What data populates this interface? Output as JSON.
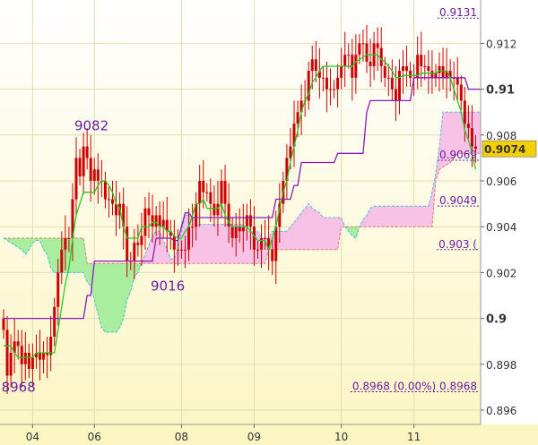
{
  "chart_data": {
    "type": "candlestick",
    "title": "",
    "xlabel": "",
    "ylabel": "",
    "y_range": [
      0.8955,
      0.9135
    ],
    "y_ticks": [
      0.896,
      0.898,
      0.9,
      0.902,
      0.904,
      0.906,
      0.908,
      0.91,
      0.912
    ],
    "y_tick_labels": [
      "0.896",
      "0.898",
      "0.9",
      "0.902",
      "0.904",
      "0.906",
      "0.908",
      "0.91",
      "0.912"
    ],
    "y_major_ticks": [
      0.9,
      0.91
    ],
    "x_tick_labels": [
      "04",
      "06",
      "08",
      "09",
      "10",
      "11"
    ],
    "x_tick_index": [
      8,
      25,
      49,
      69,
      93,
      113
    ],
    "current_price": 0.9074,
    "current_price_label": "0.9074",
    "colors": {
      "background_top": "#ffffff",
      "background_bottom": "#fbf5c2",
      "candle": "#cc0000",
      "tenkan": "#22cc22",
      "kijun": "#8a1ab8",
      "cloud_bull": "#a8ee9e",
      "cloud_bear": "#f8c2e6",
      "annotation": "#6a1fa2",
      "price_badge": "#f5d000"
    },
    "annotations": {
      "swing_high": {
        "label": "9082",
        "value": 0.9082
      },
      "swing_mid": {
        "label": "9016",
        "value": 0.9016
      },
      "swing_low": {
        "label": "8968",
        "value": 0.8968
      }
    },
    "levels": [
      {
        "label": "0.9131",
        "value": 0.9131
      },
      {
        "label": "0.9069",
        "value": 0.9069
      },
      {
        "label": "0.9049",
        "value": 0.9049
      },
      {
        "label": "0.903 (",
        "value": 0.903
      },
      {
        "label": "0.8968 (0.00%) 0.8968",
        "value": 0.8968
      }
    ],
    "closes": [
      0.8995,
      0.8975,
      0.8985,
      0.899,
      0.8988,
      0.898,
      0.8985,
      0.8978,
      0.8983,
      0.8985,
      0.8982,
      0.8985,
      0.8984,
      0.8992,
      0.9005,
      0.902,
      0.903,
      0.9035,
      0.9035,
      0.9052,
      0.907,
      0.9062,
      0.9075,
      0.907,
      0.906,
      0.9065,
      0.906,
      0.906,
      0.9052,
      0.9052,
      0.905,
      0.9045,
      0.905,
      0.904,
      0.9025,
      0.9025,
      0.9033,
      0.9032,
      0.9036,
      0.9048,
      0.9045,
      0.904,
      0.9045,
      0.904,
      0.9043,
      0.9038,
      0.9036,
      0.903,
      0.903,
      0.903,
      0.903,
      0.904,
      0.904,
      0.905,
      0.906,
      0.9055,
      0.9055,
      0.905,
      0.9045,
      0.905,
      0.906,
      0.905,
      0.904,
      0.9035,
      0.904,
      0.9038,
      0.904,
      0.9045,
      0.904,
      0.903,
      0.903,
      0.9035,
      0.9035,
      0.903,
      0.9025,
      0.904,
      0.905,
      0.906,
      0.907,
      0.9075,
      0.9085,
      0.909,
      0.9095,
      0.9095,
      0.9108,
      0.9113,
      0.9108,
      0.9105,
      0.9105,
      0.91,
      0.91,
      0.91,
      0.9105,
      0.911,
      0.9115,
      0.9115,
      0.9105,
      0.9115,
      0.912,
      0.912,
      0.9112,
      0.911,
      0.912,
      0.9118,
      0.911,
      0.9105,
      0.9105,
      0.91,
      0.9095,
      0.9108,
      0.911,
      0.9108,
      0.9105,
      0.9105,
      0.9115,
      0.911,
      0.911,
      0.9108,
      0.9105,
      0.9107,
      0.911,
      0.9105,
      0.9108,
      0.9105,
      0.9105,
      0.9102,
      0.9095,
      0.9085,
      0.9083,
      0.9075,
      0.9074
    ],
    "tenkan": [
      0.8988,
      0.8988,
      0.8988,
      0.8985,
      0.8983,
      0.8983,
      0.8983,
      0.8983,
      0.8983,
      0.8985,
      0.8985,
      0.8985,
      0.8985,
      0.8985,
      0.8985,
      0.8995,
      0.9005,
      0.9015,
      0.9022,
      0.9035,
      0.9045,
      0.905,
      0.9055,
      0.9055,
      0.9055,
      0.9055,
      0.9058,
      0.906,
      0.906,
      0.9058,
      0.9055,
      0.905,
      0.9048,
      0.904,
      0.9035,
      0.9035,
      0.9035,
      0.9035,
      0.904,
      0.904,
      0.904,
      0.9042,
      0.9042,
      0.904,
      0.904,
      0.9038,
      0.9038,
      0.9036,
      0.9035,
      0.9035,
      0.9038,
      0.904,
      0.9045,
      0.905,
      0.905,
      0.9052,
      0.9048,
      0.9048,
      0.9048,
      0.9048,
      0.905,
      0.9045,
      0.9042,
      0.904,
      0.904,
      0.904,
      0.904,
      0.904,
      0.9038,
      0.9036,
      0.9034,
      0.9034,
      0.9034,
      0.903,
      0.9035,
      0.904,
      0.9048,
      0.9055,
      0.906,
      0.9068,
      0.9075,
      0.9082,
      0.909,
      0.9095,
      0.9098,
      0.9103,
      0.9105,
      0.9108,
      0.911,
      0.911,
      0.911,
      0.911,
      0.911,
      0.911,
      0.911,
      0.911,
      0.911,
      0.9112,
      0.9113,
      0.9114,
      0.9115,
      0.9115,
      0.9115,
      0.9115,
      0.9113,
      0.9112,
      0.911,
      0.9108,
      0.9105,
      0.9105,
      0.9106,
      0.9106,
      0.9106,
      0.9106,
      0.9106,
      0.9107,
      0.9107,
      0.9107,
      0.9107,
      0.9107,
      0.9108,
      0.9108,
      0.9108,
      0.9105,
      0.91,
      0.9095,
      0.909,
      0.9082,
      0.9078,
      0.9072,
      0.9065
    ],
    "kijun": [
      0.9,
      0.9,
      0.9,
      0.9,
      0.9,
      0.9,
      0.9,
      0.9,
      0.9,
      0.9,
      0.9,
      0.9,
      0.9,
      0.9,
      0.9,
      0.9,
      0.9,
      0.9,
      0.9,
      0.9,
      0.9,
      0.9,
      0.9,
      0.901,
      0.901,
      0.9025,
      0.9025,
      0.9025,
      0.9025,
      0.9025,
      0.9025,
      0.9025,
      0.9025,
      0.9025,
      0.9025,
      0.9025,
      0.9025,
      0.9025,
      0.9025,
      0.9025,
      0.9025,
      0.9025,
      0.9035,
      0.9035,
      0.9035,
      0.9035,
      0.9035,
      0.9034,
      0.9034,
      0.904,
      0.9046,
      0.9046,
      0.9044,
      0.9044,
      0.9044,
      0.9044,
      0.9044,
      0.9044,
      0.9044,
      0.9044,
      0.9044,
      0.9044,
      0.9044,
      0.9044,
      0.9044,
      0.9044,
      0.9044,
      0.9044,
      0.9044,
      0.9044,
      0.9044,
      0.9044,
      0.9044,
      0.9044,
      0.9044,
      0.9052,
      0.9052,
      0.9052,
      0.9052,
      0.9052,
      0.9058,
      0.9058,
      0.9068,
      0.9068,
      0.9068,
      0.9068,
      0.9068,
      0.9068,
      0.9068,
      0.9068,
      0.9068,
      0.9068,
      0.9072,
      0.9072,
      0.9072,
      0.9072,
      0.9072,
      0.9072,
      0.9072,
      0.9072,
      0.909,
      0.9095,
      0.9095,
      0.9095,
      0.9095,
      0.9095,
      0.9095,
      0.9095,
      0.9095,
      0.9095,
      0.9095,
      0.9095,
      0.9095,
      0.9105,
      0.9105,
      0.9105,
      0.9105,
      0.9105,
      0.9105,
      0.9105,
      0.9105,
      0.9105,
      0.9105,
      0.9105,
      0.9105,
      0.9105,
      0.9105,
      0.9105,
      0.91,
      0.91,
      0.91,
      0.91,
      0.91
    ],
    "cloud": {
      "start_index": 0,
      "span_a": [
        0.9035,
        0.9035,
        0.9035,
        0.9035,
        0.9035,
        0.9035,
        0.9035,
        0.9035,
        0.9035,
        0.9035,
        0.9035,
        0.9035,
        0.9035,
        0.9035,
        0.9035,
        0.9035,
        0.9035,
        0.9035,
        0.9035,
        0.9035,
        0.9035,
        0.9035,
        0.9035,
        0.9024,
        0.9024,
        0.9024,
        0.9024,
        0.9024,
        0.9024,
        0.9024,
        0.9024,
        0.9024,
        0.9024,
        0.9024,
        0.9024,
        0.9024,
        0.9024,
        0.9024,
        0.9024,
        0.9024,
        0.9024,
        0.9024,
        0.9024,
        0.9024,
        0.9024,
        0.9024,
        0.9024,
        0.9024,
        0.9024,
        0.9024,
        0.9024,
        0.9024,
        0.9024,
        0.9024,
        0.9024,
        0.9024,
        0.9024,
        0.9024,
        0.9024,
        0.9024,
        0.9024,
        0.9024,
        0.9024,
        0.9024,
        0.9024,
        0.9024,
        0.9024,
        0.9024,
        0.9024,
        0.9024,
        0.9024,
        0.9024,
        0.9024,
        0.903,
        0.903,
        0.903,
        0.903,
        0.903,
        0.903,
        0.903,
        0.903,
        0.903,
        0.903,
        0.903,
        0.903,
        0.903,
        0.903,
        0.903,
        0.903,
        0.903,
        0.903,
        0.903,
        0.903,
        0.904,
        0.904,
        0.904,
        0.904,
        0.904,
        0.904,
        0.904,
        0.904,
        0.904,
        0.904,
        0.904,
        0.904,
        0.904,
        0.904,
        0.904,
        0.904,
        0.904,
        0.904,
        0.904,
        0.904,
        0.904,
        0.904,
        0.904,
        0.904,
        0.904,
        0.904,
        0.906,
        0.9065,
        0.9066,
        0.9067,
        0.9068,
        0.907,
        0.9072,
        0.9072,
        0.9072,
        0.9072,
        0.9072,
        0.9072,
        0.9072,
        0.9072,
        0.9072,
        0.9072
      ],
      "span_b": [
        0.9035,
        0.9034,
        0.9033,
        0.9032,
        0.9031,
        0.903,
        0.9028,
        0.903,
        0.9033,
        0.9034,
        0.9034,
        0.903,
        0.9028,
        0.9022,
        0.902,
        0.902,
        0.902,
        0.902,
        0.902,
        0.902,
        0.902,
        0.902,
        0.902,
        0.9016,
        0.9014,
        0.9008,
        0.9002,
        0.8996,
        0.8994,
        0.8994,
        0.8994,
        0.8994,
        0.8996,
        0.9,
        0.9008,
        0.9012,
        0.9018,
        0.902,
        0.9024,
        0.9028,
        0.9032,
        0.9036,
        0.9038,
        0.9038,
        0.9034,
        0.903,
        0.9026,
        0.9026,
        0.903,
        0.9038,
        0.9045,
        0.9045,
        0.9044,
        0.9041,
        0.9041,
        0.9041,
        0.9041,
        0.9041,
        0.9041,
        0.9041,
        0.9041,
        0.9041,
        0.9041,
        0.9041,
        0.9041,
        0.9041,
        0.9041,
        0.9038,
        0.9038,
        0.9038,
        0.9038,
        0.9035,
        0.9035,
        0.9035,
        0.9038,
        0.9038,
        0.9038,
        0.9038,
        0.9038,
        0.904,
        0.9042,
        0.9044,
        0.9046,
        0.9048,
        0.905,
        0.9048,
        0.9047,
        0.9046,
        0.9044,
        0.9044,
        0.9044,
        0.9044,
        0.9044,
        0.9044,
        0.904,
        0.9038,
        0.9036,
        0.9035,
        0.904,
        0.9043,
        0.9045,
        0.9048,
        0.9049,
        0.9049,
        0.9049,
        0.9049,
        0.9049,
        0.9049,
        0.9049,
        0.9049,
        0.9049,
        0.9049,
        0.9049,
        0.9049,
        0.9049,
        0.9049,
        0.9049,
        0.9049,
        0.9055,
        0.9063,
        0.9075,
        0.909,
        0.909,
        0.909,
        0.909,
        0.909,
        0.909,
        0.909,
        0.909,
        0.909,
        0.909,
        0.909,
        0.909,
        0.909,
        0.909,
        0.909
      ]
    }
  }
}
